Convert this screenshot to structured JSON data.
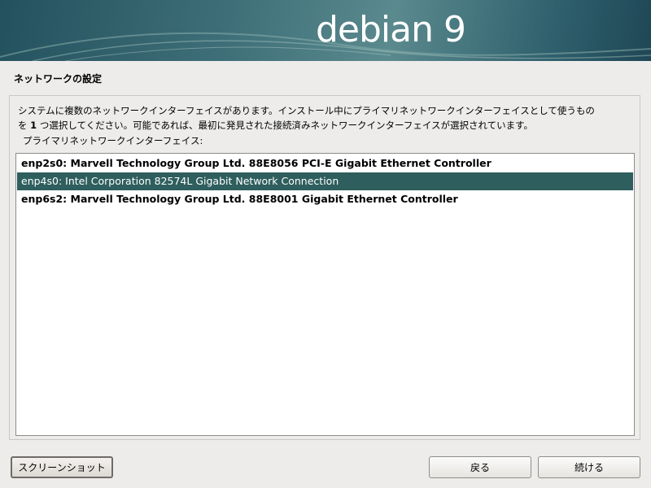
{
  "banner": {
    "logo_text": "debian 9"
  },
  "page": {
    "title": "ネットワークの設定"
  },
  "description": {
    "line1": "システムに複数のネットワークインターフェイスがあります。インストール中にプライマリネットワークインターフェイスとして使うもの",
    "line2_prefix": "を ",
    "line2_number": "1",
    "line2_suffix": " つ選択してください。可能であれば、最初に発見された接続済みネットワークインターフェイスが選択されています。"
  },
  "list": {
    "label": "プライマリネットワークインターフェイス:",
    "items": [
      {
        "label": "enp2s0: Marvell Technology Group Ltd. 88E8056 PCI-E Gigabit Ethernet Controller"
      },
      {
        "label": "enp4s0: Intel Corporation 82574L Gigabit Network Connection"
      },
      {
        "label": "enp6s2: Marvell Technology Group Ltd. 88E8001 Gigabit Ethernet Controller"
      }
    ],
    "selected_index": 1
  },
  "buttons": {
    "screenshot": "スクリーンショット",
    "back": "戻る",
    "continue": "続ける"
  },
  "colors": {
    "selection": "#2e5e5e",
    "banner": "#3e6f78"
  }
}
